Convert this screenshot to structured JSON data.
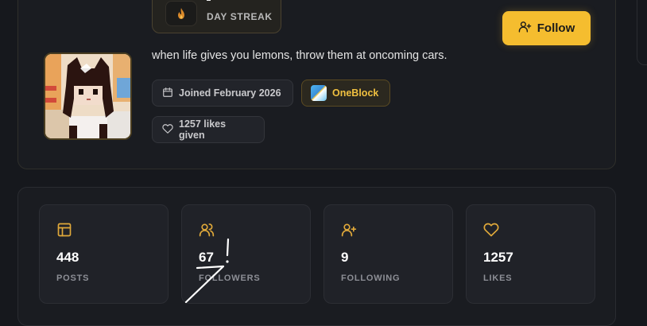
{
  "streak": {
    "label": "DAY STREAK",
    "icon": "flame-icon"
  },
  "follow_button": {
    "label": "Follow",
    "icon": "user-plus-icon",
    "color": "#f5bd2f"
  },
  "bio": "when life gives you lemons, throw them at oncoming cars.",
  "badges": {
    "joined": {
      "label": "Joined February 2026",
      "icon": "calendar-icon"
    },
    "game": {
      "label": "OneBlock",
      "icon": "oneblock-game-icon",
      "color": "#f0c040"
    },
    "likes_given": {
      "label": "1257 likes given",
      "icon": "heart-icon"
    }
  },
  "stats": [
    {
      "value": "448",
      "label": "POSTS",
      "icon": "layout-icon"
    },
    {
      "value": "67",
      "label": "FOLLOWERS",
      "icon": "users-icon"
    },
    {
      "value": "9",
      "label": "FOLLOWING",
      "icon": "user-plus-icon"
    },
    {
      "value": "1257",
      "label": "LIKES",
      "icon": "heart-icon"
    }
  ],
  "accent_color": "#e0a93a"
}
